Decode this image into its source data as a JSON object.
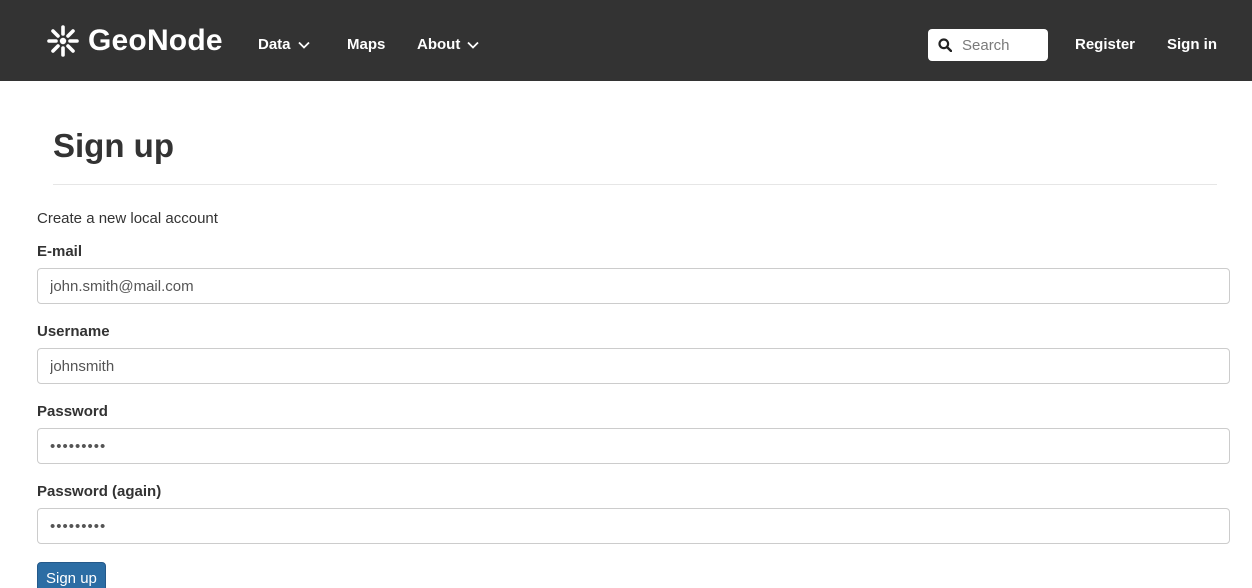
{
  "navbar": {
    "brand": "GeoNode",
    "brand_icon": "geonode-logo-icon",
    "items": [
      {
        "label": "Data",
        "has_dropdown": true
      },
      {
        "label": "Maps",
        "has_dropdown": false
      },
      {
        "label": "About",
        "has_dropdown": true
      }
    ],
    "search": {
      "placeholder": "Search",
      "value": "",
      "icon": "search-icon"
    },
    "register_label": "Register",
    "signin_label": "Sign in"
  },
  "page": {
    "title": "Sign up",
    "intro": "Create a new local account"
  },
  "form": {
    "email": {
      "label": "E-mail",
      "value": "john.smith@mail.com"
    },
    "username": {
      "label": "Username",
      "value": "johnsmith"
    },
    "password": {
      "label": "Password",
      "value": "•••••••••"
    },
    "password_again": {
      "label": "Password (again)",
      "value": "•••••••••"
    },
    "submit_label": "Sign up"
  },
  "colors": {
    "navbar_bg": "#333333",
    "button_bg": "#2c6da4",
    "text": "#333333"
  }
}
